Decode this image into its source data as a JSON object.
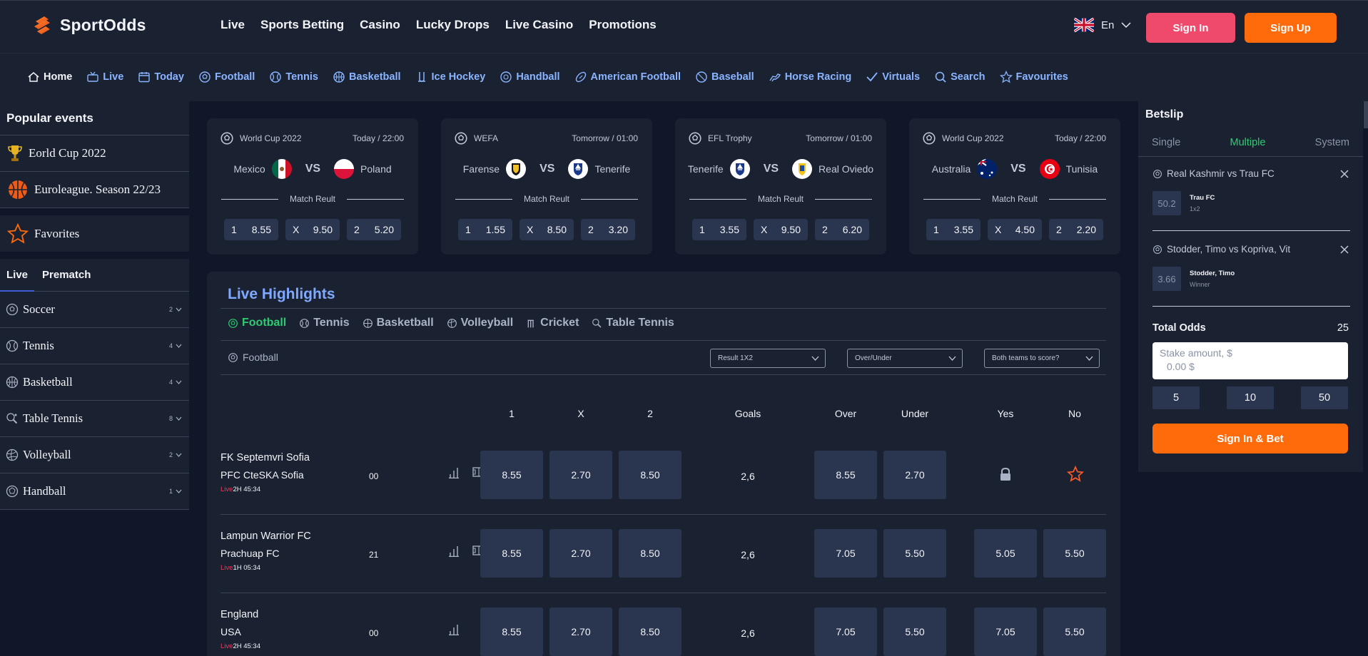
{
  "header": {
    "brand": "SportOdds",
    "nav": [
      "Live",
      "Sports Betting",
      "Casino",
      "Lucky Drops",
      "Live Casino",
      "Promotions"
    ],
    "language": "En",
    "sign_in": "Sign In",
    "sign_up": "Sign Up",
    "colors": {
      "bg": "#1a2232",
      "signin": "#ef4a6b",
      "signup": "#ff6a0a",
      "nav_accent": "#8ab4ff"
    }
  },
  "sports_nav": [
    {
      "label": "Home",
      "icon": "home-icon",
      "active": true
    },
    {
      "label": "Live",
      "icon": "live-tv-icon"
    },
    {
      "label": "Today",
      "icon": "calendar-icon"
    },
    {
      "label": "Football",
      "icon": "football-icon"
    },
    {
      "label": "Tennis",
      "icon": "tennis-icon"
    },
    {
      "label": "Basketball",
      "icon": "basketball-icon"
    },
    {
      "label": "Ice Hockey",
      "icon": "hockey-icon"
    },
    {
      "label": "Handball",
      "icon": "handball-icon"
    },
    {
      "label": "American Football",
      "icon": "american-football-icon"
    },
    {
      "label": "Baseball",
      "icon": "baseball-icon"
    },
    {
      "label": "Horse Racing",
      "icon": "horse-icon"
    },
    {
      "label": "Virtuals",
      "icon": "check-icon"
    },
    {
      "label": "Search",
      "icon": "search-icon"
    },
    {
      "label": "Favourites",
      "icon": "star-icon"
    }
  ],
  "sidebar": {
    "popular_title": "Popular events",
    "popular": [
      {
        "label": "Eorld Cup 2022",
        "icon": "trophy-icon"
      },
      {
        "label": "Euroleague. Season 22/23",
        "icon": "basketball-icon"
      }
    ],
    "favorites": "Favorites",
    "tabs": [
      "Live",
      "Prematch"
    ],
    "sports": [
      {
        "label": "Soccer",
        "count": "2"
      },
      {
        "label": "Tennis",
        "count": "4"
      },
      {
        "label": "Basketball",
        "count": "4"
      },
      {
        "label": "Table Tennis",
        "count": "8"
      },
      {
        "label": "Volleyball",
        "count": "2"
      },
      {
        "label": "Handball",
        "count": "1"
      }
    ]
  },
  "featured": [
    {
      "competition": "World Cup 2022",
      "time": "Today / 22:00",
      "home": "Mexico",
      "away": "Poland",
      "vs": "VS",
      "market": "Match Reult",
      "odds": [
        {
          "k": "1",
          "v": "8.55"
        },
        {
          "k": "X",
          "v": "9.50"
        },
        {
          "k": "2",
          "v": "5.20"
        }
      ]
    },
    {
      "competition": "WEFA",
      "time": "Tomorrow / 01:00",
      "home": "Farense",
      "away": "Tenerife",
      "vs": "VS",
      "market": "Match Reult",
      "odds": [
        {
          "k": "1",
          "v": "1.55"
        },
        {
          "k": "X",
          "v": "8.50"
        },
        {
          "k": "2",
          "v": "3.20"
        }
      ]
    },
    {
      "competition": "EFL Trophy",
      "time": "Tomorrow / 01:00",
      "home": "Tenerife",
      "away": "Real Oviedo",
      "vs": "VS",
      "market": "Match Reult",
      "odds": [
        {
          "k": "1",
          "v": "3.55"
        },
        {
          "k": "X",
          "v": "9.50"
        },
        {
          "k": "2",
          "v": "6.20"
        }
      ]
    },
    {
      "competition": "World Cup 2022",
      "time": "Today / 22:00",
      "home": "Australia",
      "away": "Tunisia",
      "vs": "VS",
      "market": "Match Reult",
      "odds": [
        {
          "k": "1",
          "v": "3.55"
        },
        {
          "k": "X",
          "v": "4.50"
        },
        {
          "k": "2",
          "v": "2.20"
        }
      ]
    }
  ],
  "live": {
    "title": "Live Highlights",
    "tabs": [
      "Football",
      "Tennis",
      "Basketball",
      "Volleyball",
      "Cricket",
      "Table Tennis"
    ],
    "active_tab": "Football",
    "sub_label": "Football",
    "selects": [
      "Result 1X2",
      "Over/Under",
      "Both teams to score?"
    ],
    "columns": [
      "1",
      "X",
      "2",
      "Goals",
      "Over",
      "Under",
      "Yes",
      "No"
    ],
    "live_label": "Live",
    "matches": [
      {
        "home": "FK Septemvri Sofia",
        "away": "PFC CteSKA Sofia",
        "period": "2H 45:34",
        "score": "00",
        "o1": "8.55",
        "ox": "2.70",
        "o2": "8.50",
        "goals": "2,6",
        "over": "8.55",
        "under": "2.70",
        "yes": "",
        "no": "",
        "field_icon": true
      },
      {
        "home": "Lampun Warrior FC",
        "away": "Prachuap FC",
        "period": "1H 05:34",
        "score": "21",
        "o1": "8.55",
        "ox": "2.70",
        "o2": "8.50",
        "goals": "2,6",
        "over": "7.05",
        "under": "5.50",
        "yes": "5.05",
        "no": "5.50",
        "field_icon": true
      },
      {
        "home": "England",
        "away": "USA",
        "period": "2H 45:34",
        "score": "00",
        "o1": "8.55",
        "ox": "2.70",
        "o2": "8.50",
        "goals": "2,6",
        "over": "7.05",
        "under": "5.50",
        "yes": "7.05",
        "no": "5.50",
        "field_icon": false
      }
    ]
  },
  "betslip": {
    "title": "Betslip",
    "tabs": [
      "Single",
      "Multiple",
      "System"
    ],
    "active_tab": "Multiple",
    "entries": [
      {
        "match": "Real Kashmir vs Trau FC",
        "odd": "50.2",
        "pick": "Trau FC",
        "market": "1x2"
      },
      {
        "match": "Stodder, Timo vs Kopriva, Vit",
        "odd": "3.66",
        "pick": "Stodder, Timo",
        "market": "Winner"
      }
    ],
    "total_label": "Total Odds",
    "total_value": "25",
    "stake_placeholder": "Stake amount, $",
    "stake_value": "0.00 $",
    "quick": [
      "5",
      "10",
      "50"
    ],
    "bet_button": "Sign In & Bet"
  }
}
